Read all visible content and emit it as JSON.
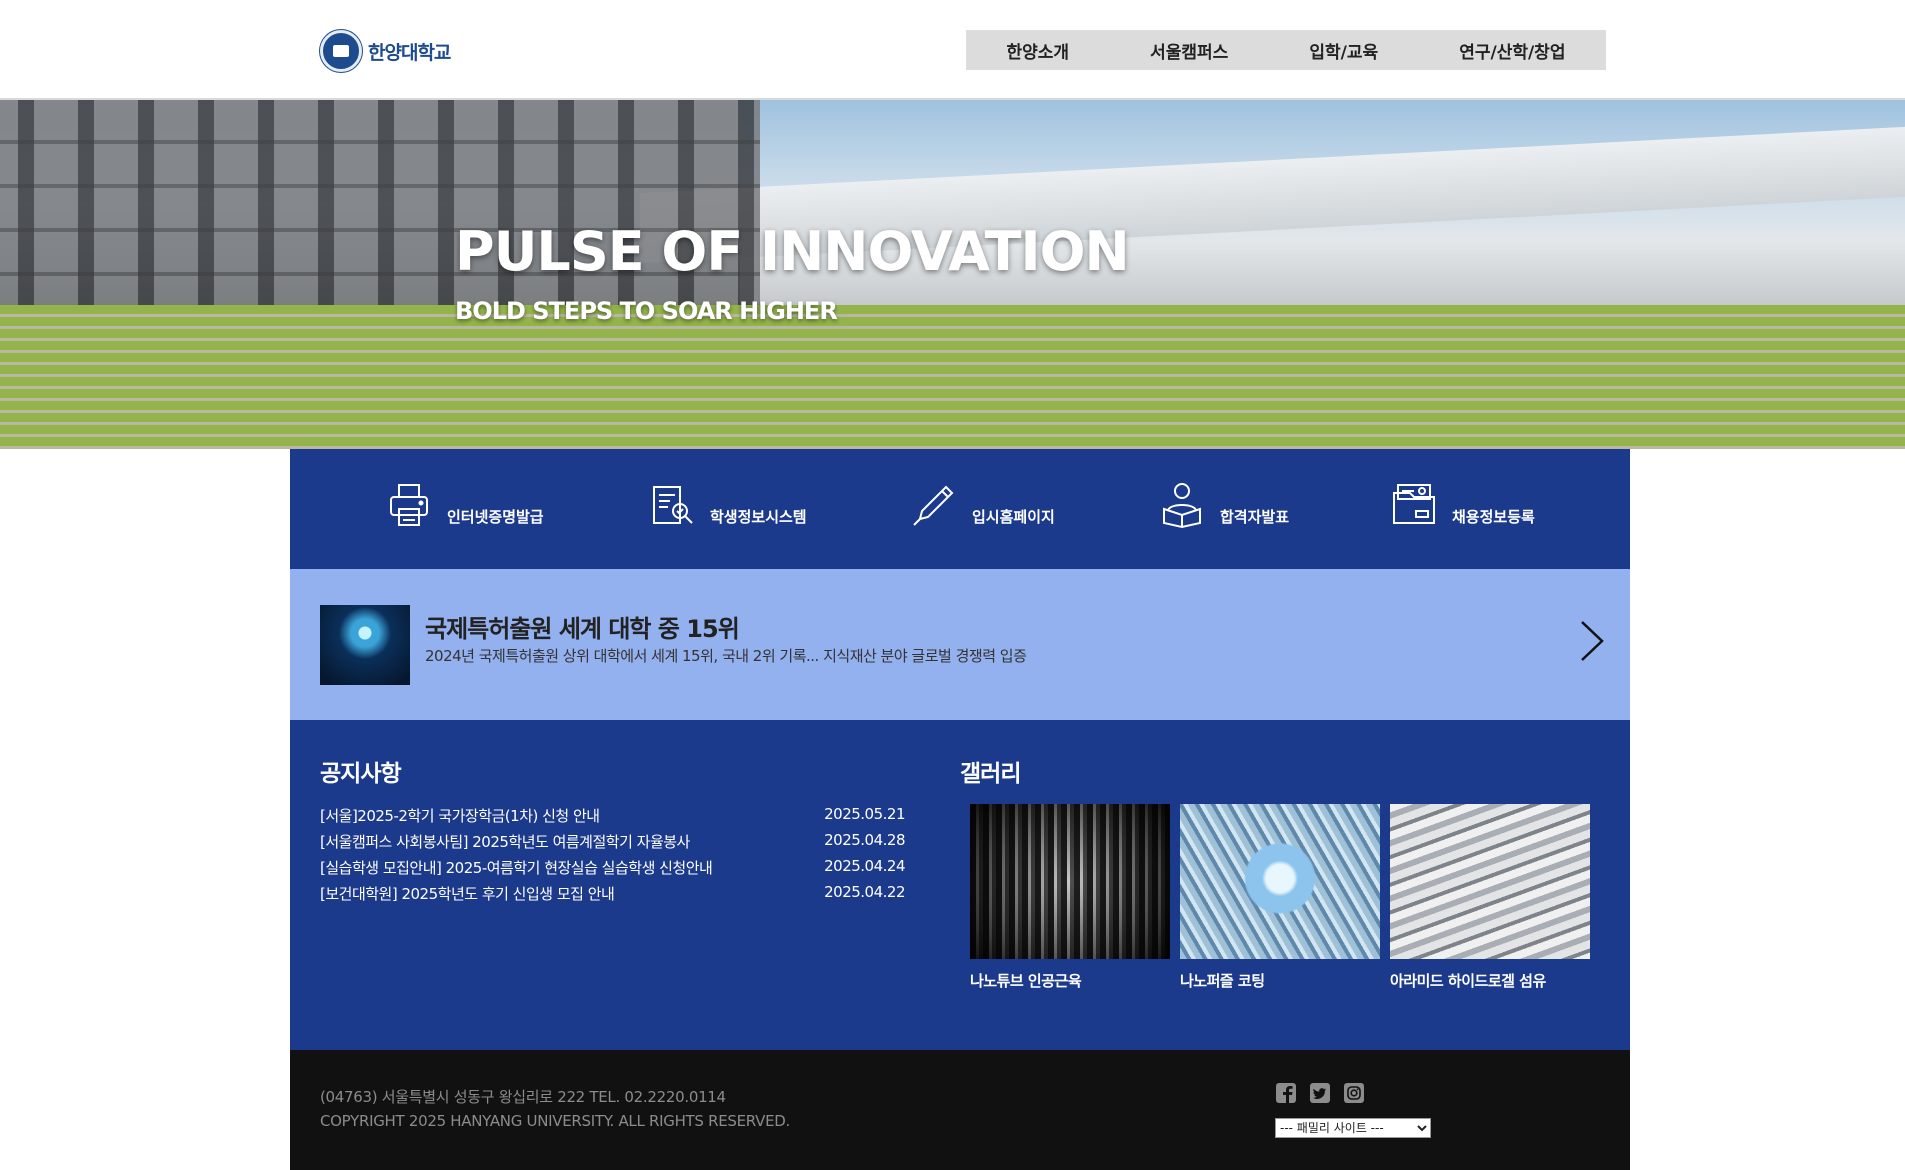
{
  "header": {
    "logo_text": "한양대학교",
    "nav": [
      "한양소개",
      "서울캠퍼스",
      "입학/교육",
      "연구/산학/창업"
    ]
  },
  "hero": {
    "title": "PULSE OF INNOVATION",
    "subtitle": "BOLD STEPS TO SOAR HIGHER"
  },
  "quick_links": [
    {
      "label": "인터넷증명발급",
      "icon": "printer-icon"
    },
    {
      "label": "학생정보시스템",
      "icon": "document-search-icon"
    },
    {
      "label": "입시홈페이지",
      "icon": "pen-icon"
    },
    {
      "label": "합격자발표",
      "icon": "reader-icon"
    },
    {
      "label": "채용정보등록",
      "icon": "folder-person-icon"
    }
  ],
  "news": {
    "title": "국제특허출원 세계 대학 중 15위",
    "description": "2024년 국제특허출원 상위 대학에서 세계 15위, 국내 2위 기록... 지식재산 분야 글로벌 경쟁력 입증",
    "next_icon": "chevron-right-icon"
  },
  "notices": {
    "title": "공지사항",
    "items": [
      {
        "text": "[서울]2025-2학기 국가장학금(1차) 신청 안내",
        "date": "2025.05.21"
      },
      {
        "text": "[서울캠퍼스 사회봉사팀] 2025학년도 여름계절학기 자율봉사",
        "date": "2025.04.28"
      },
      {
        "text": "[실습학생 모집안내] 2025-여름학기 현장실습 실습학생 신청안내",
        "date": "2025.04.24"
      },
      {
        "text": "[보건대학원] 2025학년도 후기 신입생 모집 안내",
        "date": "2025.04.22"
      }
    ]
  },
  "gallery": {
    "title": "갤러리",
    "items": [
      {
        "caption": "나노튜브 인공근육"
      },
      {
        "caption": "나노퍼즐 코팅"
      },
      {
        "caption": "아라미드 하이드로겔 섬유"
      }
    ]
  },
  "footer": {
    "address": "(04763) 서울특별시 성동구 왕십리로 222 TEL. 02.2220.0114",
    "copyright": "COPYRIGHT 2025 HANYANG UNIVERSITY. ALL RIGHTS RESERVED.",
    "social": [
      "facebook-icon",
      "twitter-icon",
      "instagram-icon"
    ],
    "family_site": "--- 패밀리 사이트 ---"
  },
  "colors": {
    "primary_blue": "#1c3a8c",
    "light_blue": "#93b0ef",
    "footer_bg": "#111111",
    "nav_bg": "#dcdcdc"
  }
}
